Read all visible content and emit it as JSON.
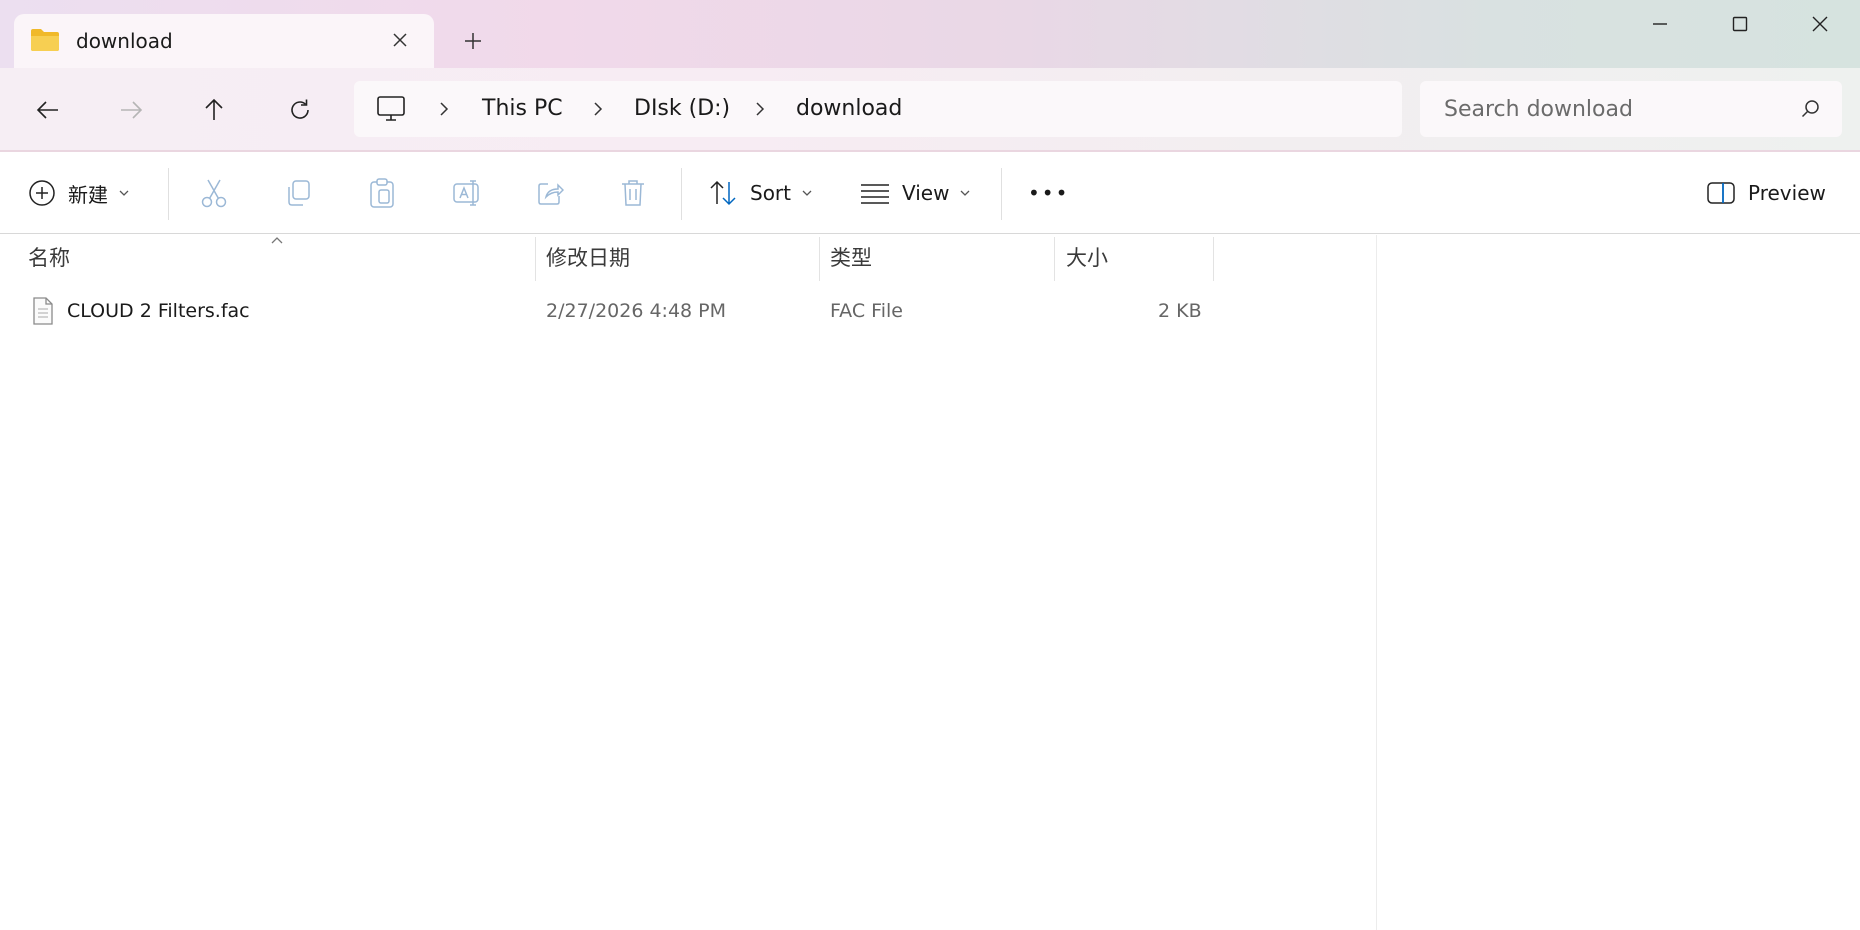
{
  "window": {
    "tab_title": "download",
    "new_tab_symbol": "+"
  },
  "nav": {
    "back_icon": "arrow-left-icon",
    "forward_icon": "arrow-right-icon",
    "up_icon": "arrow-up-icon",
    "refresh_icon": "refresh-icon"
  },
  "breadcrumb": {
    "items": [
      "This PC",
      "DIsk (D:)",
      "download"
    ]
  },
  "search": {
    "placeholder": "Search download",
    "value": ""
  },
  "toolbar": {
    "new_label": "新建",
    "sort_label": "Sort",
    "view_label": "View",
    "more_label": "•••",
    "preview_label": "Preview"
  },
  "table": {
    "headers": [
      "名称",
      "修改日期",
      "类型",
      "大小"
    ],
    "rows": [
      {
        "name": "CLOUD 2 Filters.fac",
        "modified": "2/27/2026 4:48 PM",
        "type": "FAC File",
        "size": "2 KB"
      }
    ]
  },
  "colors": {
    "accent": "#0067c0",
    "folder": "#f4c430",
    "disabled_icon": "#9bb8d6"
  }
}
